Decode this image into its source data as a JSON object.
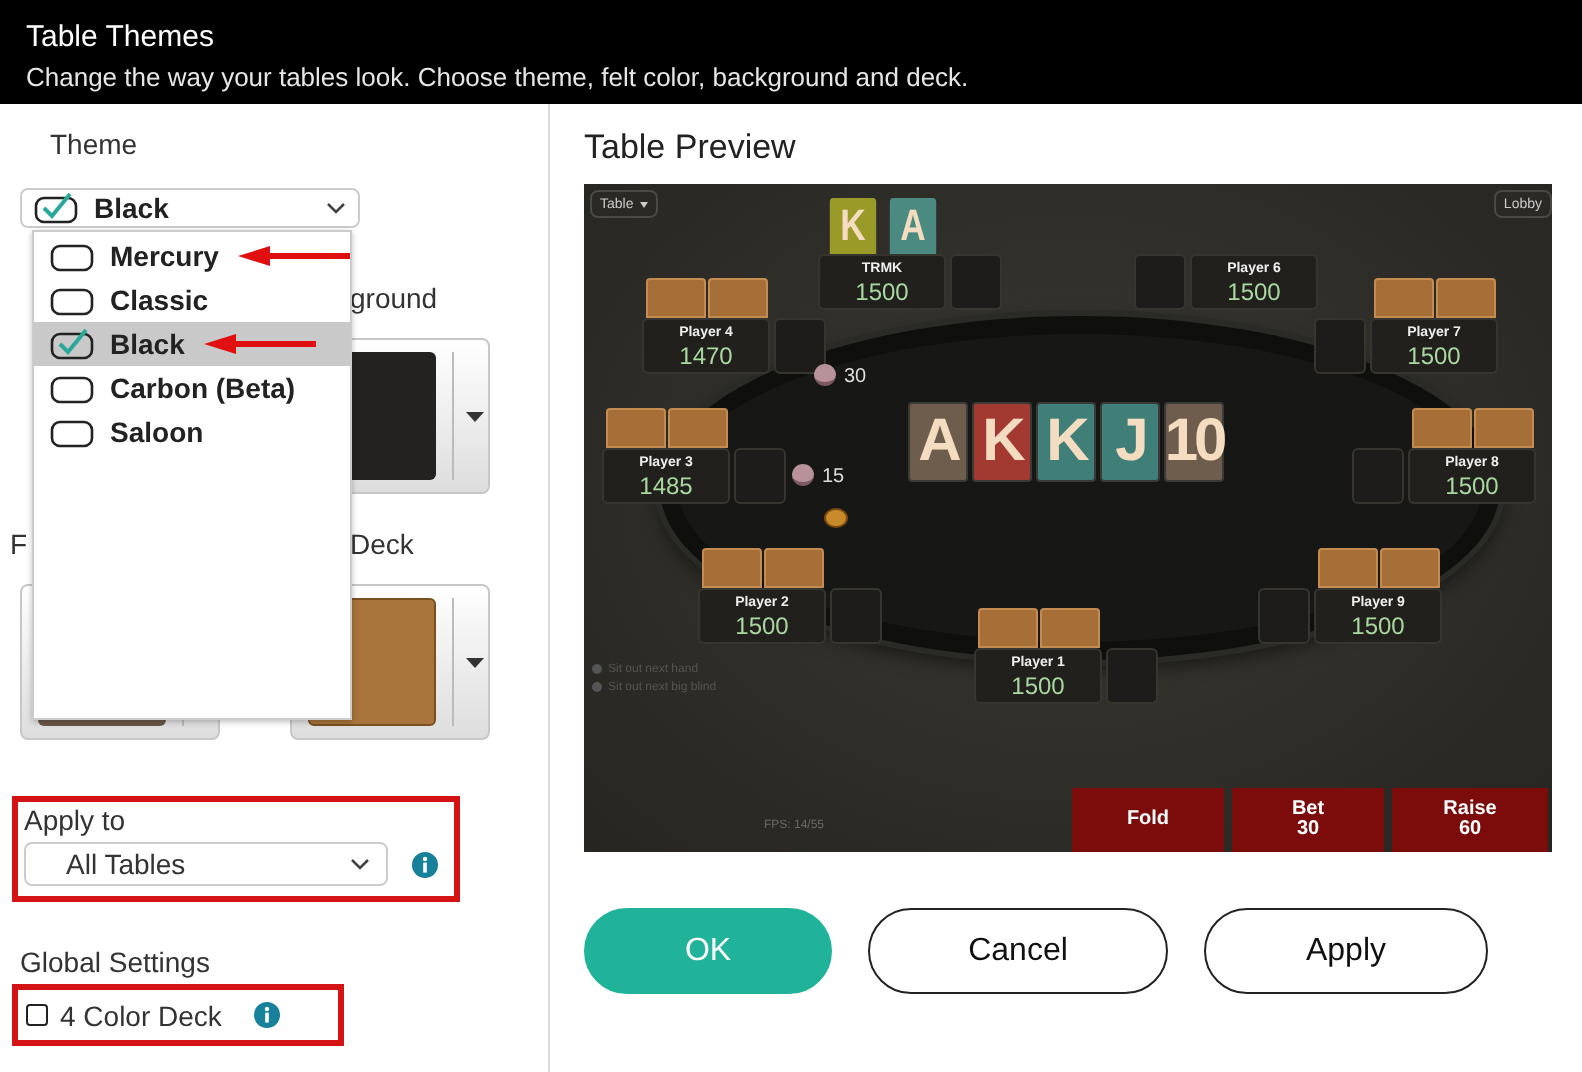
{
  "header": {
    "title": "Table Themes",
    "subtitle": "Change the way your tables look. Choose theme, felt color, background and deck."
  },
  "theme": {
    "label": "Theme",
    "value": "Black",
    "options": [
      {
        "label": "Mercury",
        "selected": false,
        "annotated": true
      },
      {
        "label": "Classic",
        "selected": false,
        "annotated": false
      },
      {
        "label": "Black",
        "selected": true,
        "annotated": true
      },
      {
        "label": "Carbon (Beta)",
        "selected": false,
        "annotated": false
      },
      {
        "label": "Saloon",
        "selected": false,
        "annotated": false
      }
    ]
  },
  "background": {
    "label": "ground"
  },
  "felt": {
    "label": "F"
  },
  "deck": {
    "label": "Deck"
  },
  "apply_to": {
    "label": "Apply to",
    "value": "All Tables",
    "highlighted": true
  },
  "global_settings": {
    "label": "Global Settings",
    "four_color_deck": {
      "label": "4 Color Deck",
      "checked": false,
      "highlighted": true
    }
  },
  "preview": {
    "title": "Table Preview",
    "table_menu": "Table",
    "lobby": "Lobby",
    "seats": [
      {
        "name": "TRMK",
        "stack": "1500",
        "face_down_cards": false,
        "hole_cards": [
          {
            "rank": "K",
            "color": "#9a9a28"
          },
          {
            "rank": "A",
            "color": "#4b8a80"
          }
        ]
      },
      {
        "name": "Player 6",
        "stack": "1500",
        "face_down_cards": false
      },
      {
        "name": "Player 4",
        "stack": "1470",
        "face_down_cards": true
      },
      {
        "name": "Player 7",
        "stack": "1500",
        "face_down_cards": true
      },
      {
        "name": "Player 3",
        "stack": "1485",
        "face_down_cards": true
      },
      {
        "name": "Player 8",
        "stack": "1500",
        "face_down_cards": true
      },
      {
        "name": "Player 2",
        "stack": "1500",
        "face_down_cards": true
      },
      {
        "name": "Player 9",
        "stack": "1500",
        "face_down_cards": true
      },
      {
        "name": "Player 1",
        "stack": "1500",
        "face_down_cards": true
      }
    ],
    "board": [
      {
        "rank": "A",
        "color": "#6e5c4c"
      },
      {
        "rank": "K",
        "color": "#a23a32"
      },
      {
        "rank": "K",
        "color": "#3f7f78"
      },
      {
        "rank": "J",
        "color": "#3f7f78"
      },
      {
        "rank": "10",
        "color": "#6e5c4c"
      }
    ],
    "bets": [
      {
        "amount": "30"
      },
      {
        "amount": "15"
      }
    ],
    "sit_out_options": [
      {
        "label": "Sit out next hand",
        "checked": false
      },
      {
        "label": "Sit out next big blind",
        "checked": false
      }
    ],
    "fps": "FPS: 14/55",
    "actions": [
      {
        "label": "Fold"
      },
      {
        "label": "Bet",
        "amount": "30"
      },
      {
        "label": "Raise",
        "amount": "60"
      }
    ]
  },
  "buttons": [
    {
      "label": "OK",
      "kind": "primary"
    },
    {
      "label": "Cancel",
      "kind": "secondary"
    },
    {
      "label": "Apply",
      "kind": "secondary"
    }
  ]
}
